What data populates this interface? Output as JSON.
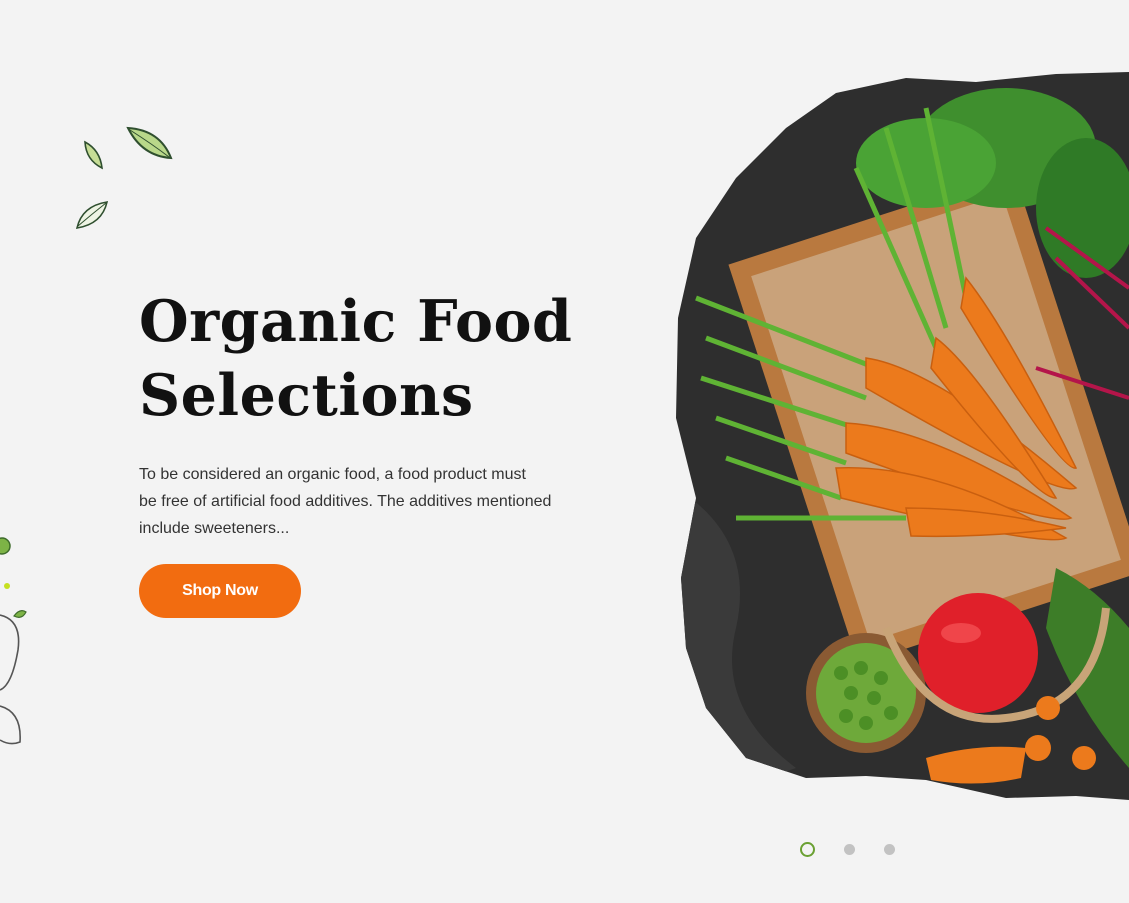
{
  "hero": {
    "title_line1": "Organic Food",
    "title_line2": "Selections",
    "description_line1": "To be considered an organic food, a food product must",
    "description_line2": "be free of artificial food additives. The additives mentioned",
    "description_line3": "include sweeteners...",
    "cta_label": "Shop Now"
  },
  "slider": {
    "slide_count": 3,
    "active_index": 0
  },
  "colors": {
    "background": "#f3f3f3",
    "cta": "#f26c10",
    "accent_green": "#6aa032",
    "dot_inactive": "#c2c2c2",
    "heading": "#111111"
  },
  "icons": [
    "leaf-icon",
    "vegetable-doodle-icon"
  ]
}
